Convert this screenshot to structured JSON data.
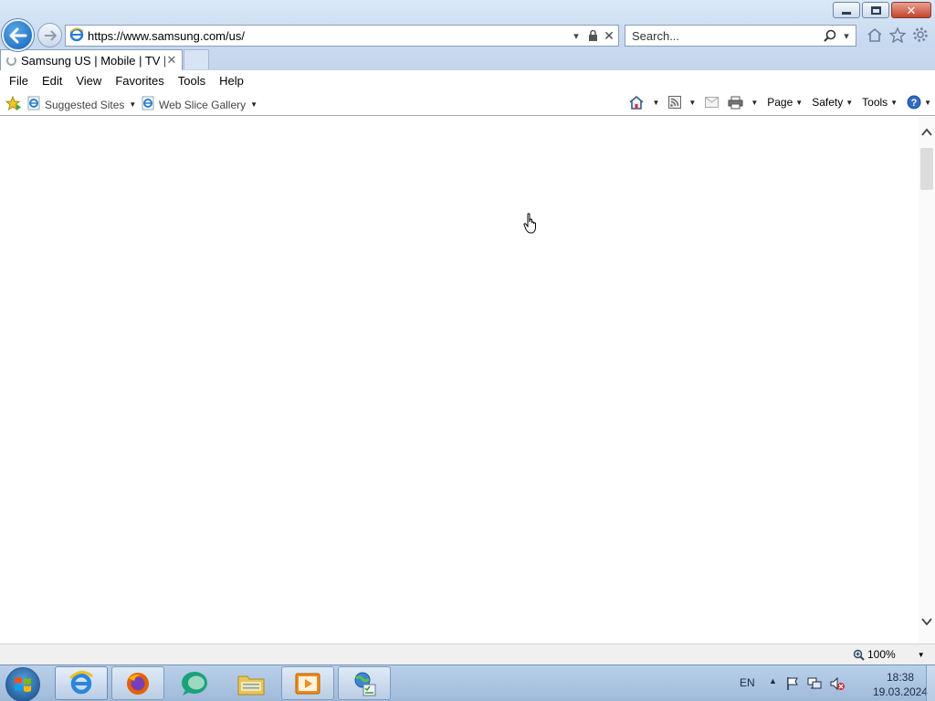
{
  "browser": {
    "address_url": "https://www.samsung.com/us/",
    "search_placeholder": "Search...",
    "tab_title": "Samsung US | Mobile | TV | ...",
    "menu": [
      "File",
      "Edit",
      "View",
      "Favorites",
      "Tools",
      "Help"
    ],
    "favorites": [
      {
        "label": "Suggested Sites"
      },
      {
        "label": "Web Slice Gallery"
      }
    ],
    "commands": {
      "page": "Page",
      "safety": "Safety",
      "tools": "Tools"
    },
    "zoom": "100%"
  },
  "taskbar": {
    "apps": [
      "internet-explorer-icon",
      "firefox-icon",
      "chat-bubble-icon",
      "file-explorer-icon",
      "media-player-icon",
      "network-globe-icon"
    ],
    "language": "EN",
    "time": "18:38",
    "date": "19.03.2024"
  },
  "colors": {
    "chrome_blue": "#c5d8ef",
    "close_red": "#c4442c",
    "back_button": "#1463b8"
  }
}
